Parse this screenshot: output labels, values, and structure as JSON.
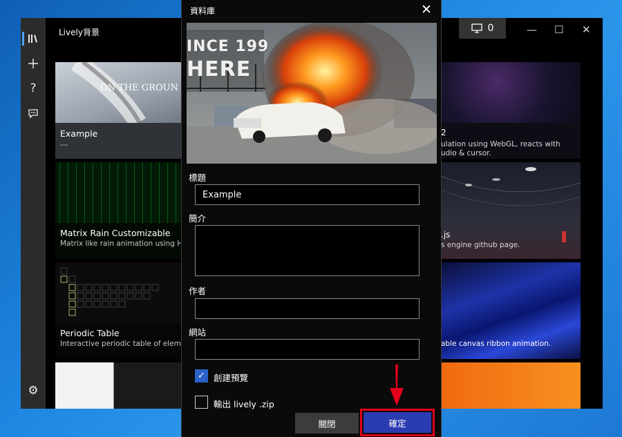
{
  "app": {
    "title": "Lively背景",
    "count": "0",
    "rail_icons": [
      "library-icon",
      "plus-icon",
      "help-icon",
      "feedback-icon",
      "settings-icon"
    ],
    "cards": [
      {
        "title": "Example",
        "desc": "---",
        "thumb_text": "ON THE GROUN"
      },
      {
        "title": "Matrix Rain Customizable",
        "desc": "Matrix like rain animation using HTM"
      },
      {
        "title": "Periodic Table",
        "desc": "Interactive periodic table of element"
      },
      {
        "title": "",
        "desc": ""
      }
    ],
    "right_cards": [
      {
        "line1": "2",
        "line2": "ulation using WebGL, reacts with",
        "line3": "udio & cursor."
      },
      {
        "line1": ".js",
        "line2": "s engine github page.",
        "line3": ""
      },
      {
        "line1": "",
        "line2": "able canvas ribbon animation.",
        "line3": ""
      }
    ]
  },
  "dialog": {
    "title": "資料庫",
    "preview_sign_1": "INCE 199",
    "preview_sign_2": "HERE",
    "fields": {
      "title_label": "標題",
      "title_value": "Example",
      "desc_label": "簡介",
      "desc_value": "",
      "author_label": "作者",
      "author_value": "",
      "website_label": "網站",
      "website_value": ""
    },
    "checkbox_preview": {
      "label": "創建預覽",
      "checked": true
    },
    "checkbox_zip": {
      "label": "輸出 lively .zip",
      "checked": false
    },
    "btn_close": "關閉",
    "btn_ok": "確定"
  },
  "colors": {
    "accent": "#2b62c9",
    "highlight": "#e2001a",
    "ok_button": "#2b3bb0"
  }
}
